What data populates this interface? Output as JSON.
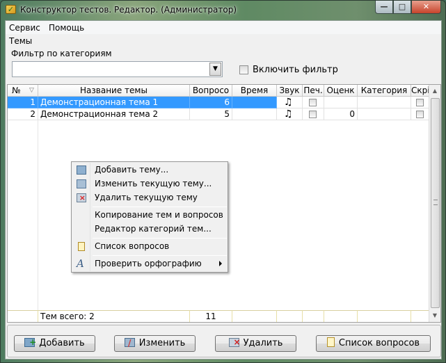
{
  "window": {
    "title": "Конструктор тестов. Редактор.  (Администратор)",
    "min_glyph": "—",
    "max_glyph": "□",
    "close_glyph": "✕"
  },
  "menu": [
    "Сервис",
    "Помощь"
  ],
  "labels": {
    "themes": "Темы",
    "filter_by_category": "Фильтр по категориям",
    "enable_filter": "Включить фильтр"
  },
  "filter": {
    "value": ""
  },
  "grid": {
    "columns": [
      "№",
      "Название темы",
      "Вопросо",
      "Время",
      "Звук",
      "Печ.",
      "Оценк",
      "Категория",
      "Скрі"
    ],
    "rows": [
      {
        "num": "1",
        "name": "Демонстрационная тема 1",
        "questions": "6",
        "time": "",
        "sound": "♫",
        "grade": "",
        "category": "",
        "selected": true
      },
      {
        "num": "2",
        "name": "Демонстрационная тема 2",
        "questions": "5",
        "time": "",
        "sound": "♫",
        "grade": "0",
        "category": "",
        "selected": false
      }
    ],
    "footer": {
      "label": "Тем всего: 2",
      "total_questions": "11"
    }
  },
  "context_menu": [
    {
      "label": "Добавить тему...",
      "icon": "add-theme-icon"
    },
    {
      "label": "Изменить текущую тему...",
      "icon": "edit-theme-icon"
    },
    {
      "label": "Удалить текущую тему",
      "icon": "delete-theme-icon"
    },
    {
      "label": "Копирование тем и вопросов",
      "icon": ""
    },
    {
      "label": "Редактор категорий тем...",
      "icon": ""
    },
    {
      "label": "Список вопросов",
      "icon": "question-list-icon"
    },
    {
      "label": "Проверить орфографию",
      "icon": "spellcheck-icon",
      "submenu": true
    }
  ],
  "buttons": {
    "add": "Добавить",
    "edit": "Изменить",
    "delete": "Удалить",
    "questions": "Список вопросов"
  }
}
